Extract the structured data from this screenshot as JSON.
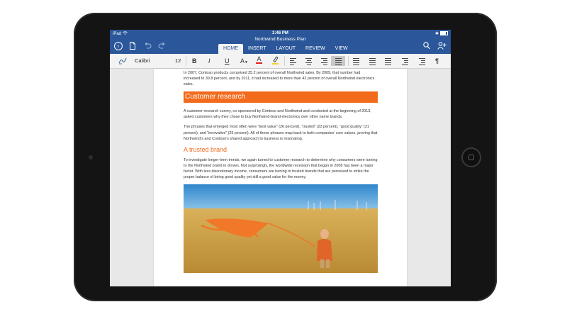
{
  "status_bar": {
    "device": "iPad",
    "wifi_icon": "wifi-icon",
    "time": "2:46 PM",
    "bluetooth_icon": "bluetooth-icon",
    "battery_icon": "battery-icon"
  },
  "document_title": "Northwind Business Plan",
  "ribbon_tabs": [
    {
      "label": "HOME",
      "active": true
    },
    {
      "label": "INSERT",
      "active": false
    },
    {
      "label": "LAYOUT",
      "active": false
    },
    {
      "label": "REVIEW",
      "active": false
    },
    {
      "label": "VIEW",
      "active": false
    }
  ],
  "toolbar": {
    "font_name": "Calibri",
    "font_size": "12",
    "bold": "B",
    "italic": "I",
    "underline": "U",
    "font_color_letter": "A",
    "paragraph_mark": "¶",
    "font_color": "#e41e1e",
    "highlight_color": "#f2d22a"
  },
  "colors": {
    "ribbon": "#2b579a",
    "accent_orange": "#f26b1d"
  },
  "document": {
    "intro": "In 2007, Contoso products comprised 35.2 percent of overall Northwind sales. By 2009, that number had increased to 39.8 percent, and by 2011, it had increased to more than 42 percent of overall Northwind electronics sales.",
    "heading_1": "Customer research",
    "para_1": "A customer research survey, co-sponsored by Contoso and Northwind and conducted at the beginning of 2013, asked customers why they chose to buy Northwind-brand electronics over other name brands.",
    "para_2": "The phrases that emerged most often were “best value” (26 percent), “trusted” (23 percent), “good quality” (21 percent), and “innovative” (29 percent). All of these phrases map back to both companies’ core values, proving that Northwind’s and Contoso’s shared approach to business is resonating.",
    "heading_2": "A trusted brand",
    "para_3": "To investigate longer-term trends, we again turned to customer research to determine why consumers were turning to the Northwind brand in droves. Not surprisingly, the worldwide recession that began in 2008 has been a major factor. With less discretionary income, consumers are turning to trusted brands that are perceived to strike the proper balance of being good quality yet still a good value for the money."
  }
}
